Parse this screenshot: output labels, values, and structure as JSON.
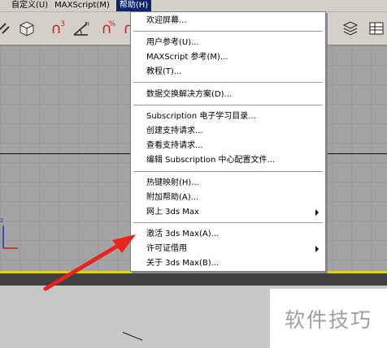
{
  "menubar": {
    "items": [
      "自定义(U)",
      "MAXScript(M)",
      "帮助(H)"
    ],
    "active_label": "帮助(H)"
  },
  "toolbar": {
    "snap3": "3",
    "snap_angle": "n",
    "snap_percent": "%"
  },
  "help_menu": {
    "items": [
      "欢迎屏幕...",
      "用户参考(U)...",
      "MAXScript 参考(M)...",
      "教程(T)...",
      "数据交换解决方案(D)...",
      "Subscription 电子学习目录...",
      "创建支持请求...",
      "查看支持请求...",
      "编辑 Subscription 中心配置文件...",
      "热键映射(H)...",
      "附加帮助(A)...",
      "网上 3ds Max",
      "激活 3ds Max(A)...",
      "许可证借用",
      "关于 3ds Max(B)..."
    ]
  },
  "watermark": {
    "text": "软件技巧"
  },
  "colors": {
    "menu_highlight": "#0a246a",
    "viewport_border": "#e8d000",
    "arrow": "#e8241c"
  }
}
